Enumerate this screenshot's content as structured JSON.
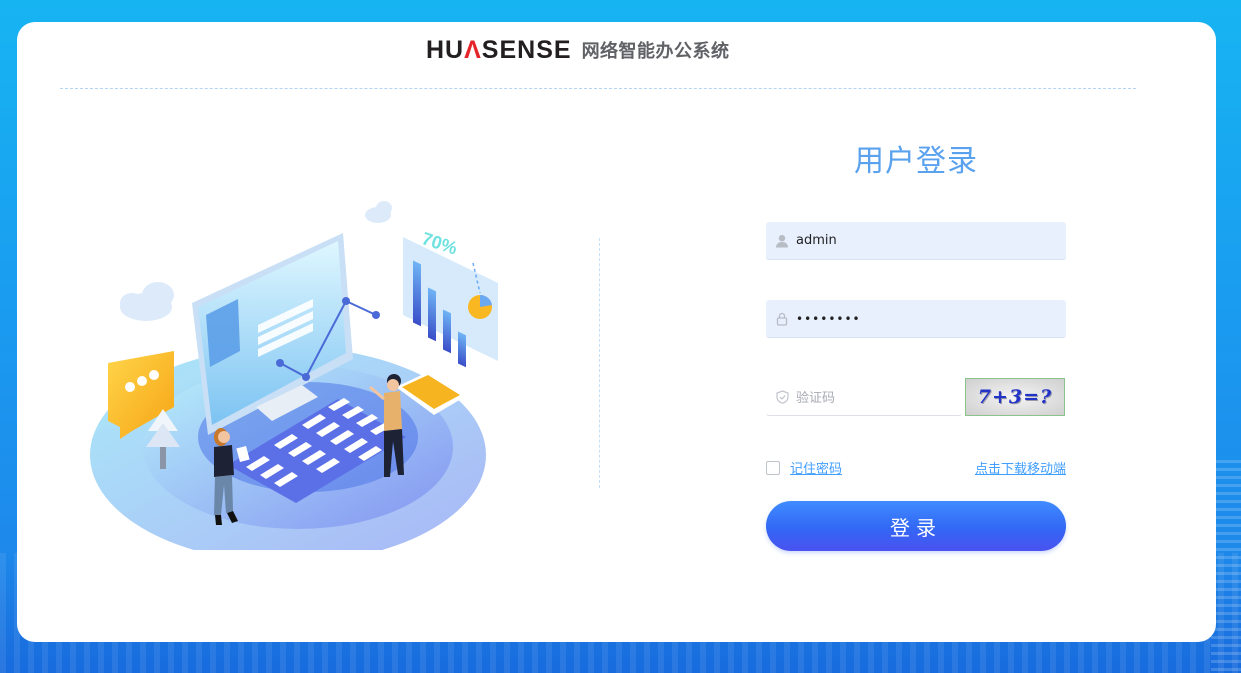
{
  "brand": {
    "logo_text_left": "HU",
    "logo_mark": "Λ",
    "logo_text_right": "SENSE",
    "subtitle": "网络智能办公系统"
  },
  "illustration": {
    "percent_label": "70%"
  },
  "login": {
    "title": "用户登录",
    "username_value": "admin",
    "password_value": "••••••••",
    "captcha_placeholder": "验证码",
    "captcha_text": "7+3=?",
    "remember_label": "记住密码",
    "download_link": "点击下载移动端",
    "submit_label": "登录"
  },
  "icons": {
    "username": "user-icon",
    "password": "lock-icon",
    "captcha": "shield-icon"
  },
  "colors": {
    "background": "#1a9cf0",
    "accent": "#409eff",
    "title": "#5aa2ee",
    "button": "#3367f5",
    "input_fill": "#e8f0fe"
  }
}
